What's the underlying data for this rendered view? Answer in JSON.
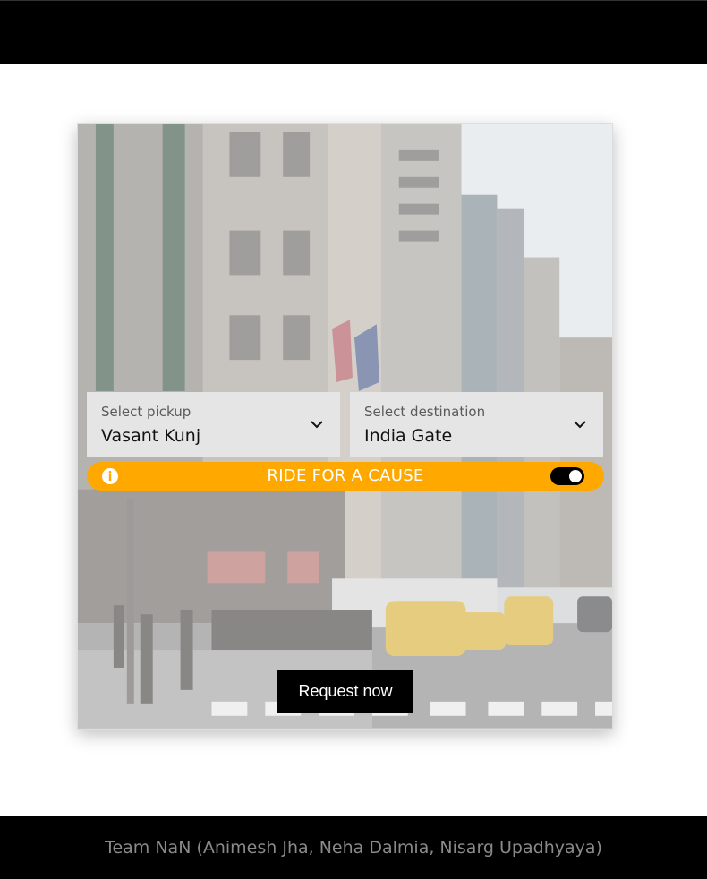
{
  "card": {
    "background_image": "city-street-photo",
    "pickup": {
      "label": "Select pickup",
      "value": "Vasant Kunj"
    },
    "destination": {
      "label": "Select destination",
      "value": "India Gate"
    },
    "cause": {
      "text": "RIDE FOR A CAUSE",
      "toggle_on": true,
      "color": "#ffa800"
    },
    "request_label": "Request now"
  },
  "footer": {
    "credits": "Team NaN (Animesh Jha, Neha Dalmia, Nisarg Upadhyaya)"
  }
}
